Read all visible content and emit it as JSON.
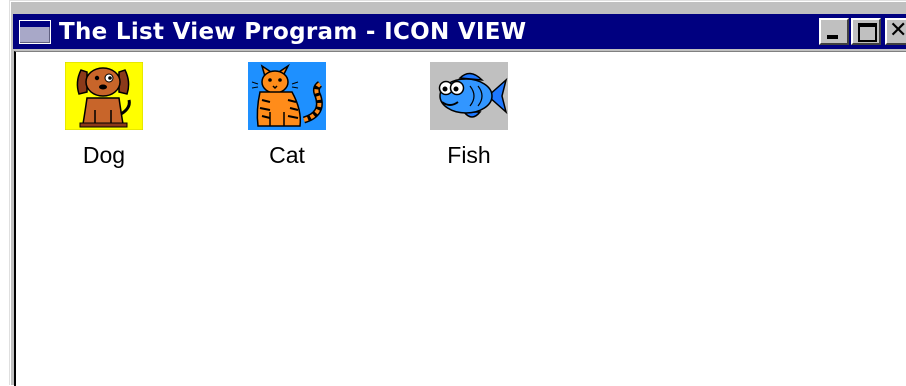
{
  "window": {
    "title": "The List View Program - ICON VIEW",
    "title_icon": "window-icon",
    "caption_close_glyph": "✕"
  },
  "colors": {
    "titlebar": "#000080",
    "dog_bg": "#ffff00",
    "cat_bg": "#1e90ff",
    "fish_bg": "#c0c0c0"
  },
  "listview": {
    "view_mode": "icon",
    "items": [
      {
        "label": "Dog",
        "icon": "dog-icon"
      },
      {
        "label": "Cat",
        "icon": "cat-icon"
      },
      {
        "label": "Fish",
        "icon": "fish-icon"
      }
    ]
  }
}
